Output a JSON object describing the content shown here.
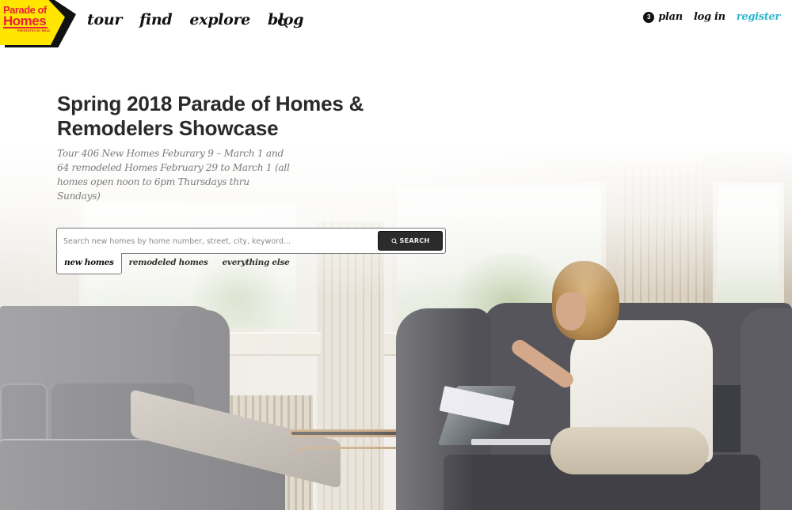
{
  "brand": {
    "logo_line1": "Parade of",
    "logo_line2": "Homes",
    "logo_sub": "PRESENTED BY BBAC",
    "colors": {
      "logo_bg": "#ffe500",
      "logo_text": "#e8213a",
      "accent_link": "#29b8cf",
      "button_bg": "#2b2b2b"
    }
  },
  "nav": {
    "items": [
      {
        "label": "tour"
      },
      {
        "label": "find"
      },
      {
        "label": "explore"
      },
      {
        "label": "blog"
      }
    ],
    "search_icon": "search-icon"
  },
  "account": {
    "plan_count": "3",
    "plan_label": "plan",
    "login_label": "log in",
    "register_label": "register"
  },
  "hero": {
    "title": "Spring 2018 Parade of Homes & Remodelers Showcase",
    "subtitle": "Tour 406 New Homes Feburary 9 – March 1 and 64 remodeled Homes February 29 to March 1 (all homes open noon to 6pm Thursdays thru Sundays)"
  },
  "search": {
    "placeholder": "Search new homes by home number, street, city, keyword...",
    "value": "",
    "button_label": "SEARCH",
    "tabs": [
      {
        "label": "new homes",
        "active": true
      },
      {
        "label": "remodeled homes",
        "active": false
      },
      {
        "label": "everything else",
        "active": false
      }
    ]
  }
}
